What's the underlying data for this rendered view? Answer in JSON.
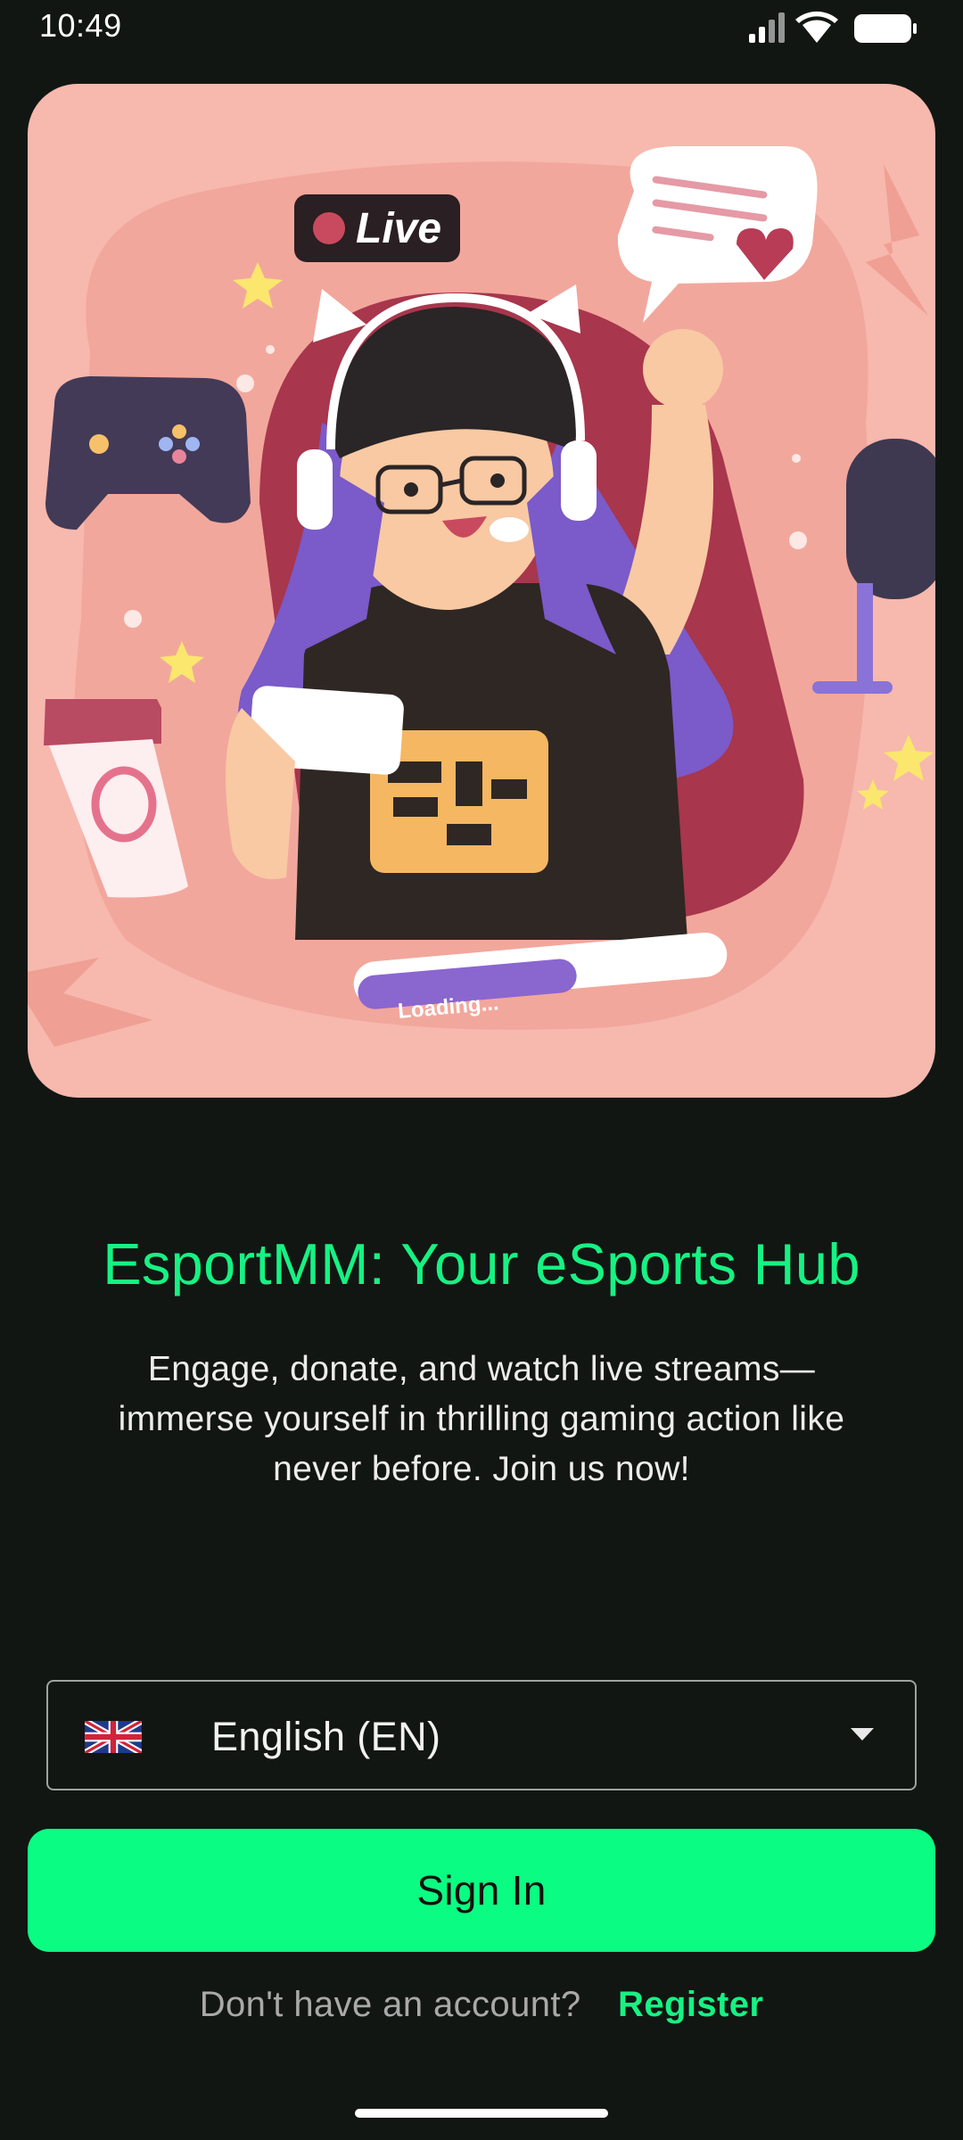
{
  "status_bar": {
    "time": "10:49",
    "icons": [
      "signal-icon",
      "wifi-icon",
      "battery-icon"
    ]
  },
  "hero": {
    "live_badge": "Live",
    "loading_label": "Loading...",
    "loading_progress": 0.6
  },
  "headline": "EsportMM: Your eSports Hub",
  "subtitle_lines": [
    "Engage, donate, and watch live streams—",
    "immerse yourself in thrilling gaming action like",
    "never before. Join us now!"
  ],
  "language_select": {
    "flag": "uk-flag-icon",
    "selected": "English (EN)"
  },
  "signin_label": "Sign In",
  "register": {
    "prompt": "Don't have an account?",
    "link": "Register"
  },
  "colors": {
    "background": "#121613",
    "accent": "#0bfc82",
    "headline": "#16f283",
    "hero_bg": "#f7b8ad"
  }
}
